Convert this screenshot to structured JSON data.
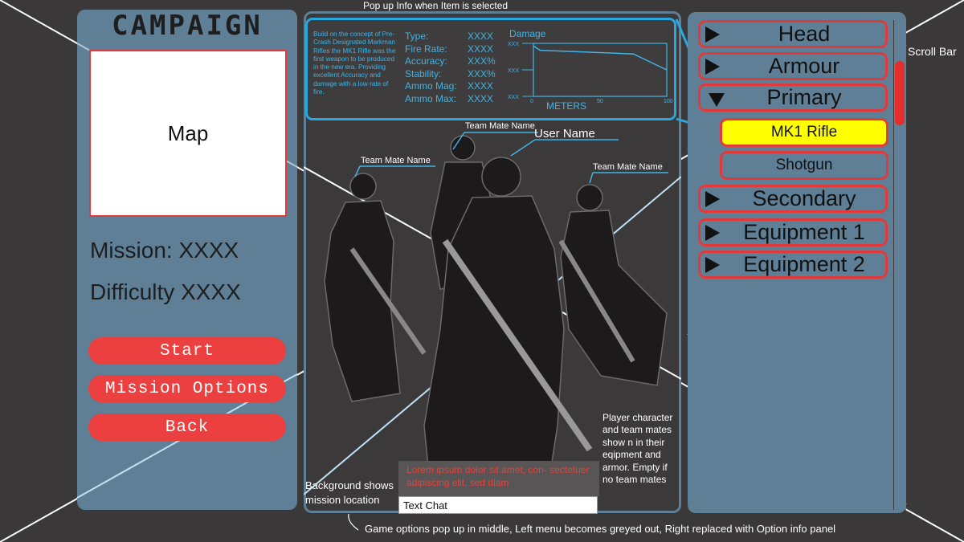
{
  "captions": {
    "popup": "Pop up Info when Item is selected",
    "bottom": "Game options pop up in middle,  Left menu becomes greyed out, Right replaced with Option info panel",
    "scroll_bar": "Scroll Bar",
    "background": "Background shows mission location",
    "player_note": "Player character and team mates show n in their eqipment and armor. Empty if no team mates"
  },
  "left": {
    "title": "CAMPAIGN",
    "map_label": "Map",
    "mission": "Mission: XXXX",
    "difficulty": "Difficulty XXXX",
    "buttons": {
      "start": "Start",
      "mission_options": "Mission Options",
      "back": "Back"
    }
  },
  "item_info": {
    "description": "Build on the concept of Pre-Crash Designated Markman Rifles the MK1 Rifle was the first weapon to be produced in the new era. Providing excellent Accuracy and damage with a low rate of fire.",
    "stats": [
      {
        "label": "Type:",
        "value": "XXXX"
      },
      {
        "label": "Fire Rate:",
        "value": "XXXX"
      },
      {
        "label": "Accuracy:",
        "value": "XXX%"
      },
      {
        "label": "Stability:",
        "value": "XXX%"
      },
      {
        "label": "Ammo Mag:",
        "value": "XXXX"
      },
      {
        "label": "Ammo Max:",
        "value": "XXXX"
      }
    ]
  },
  "chart_data": {
    "type": "line",
    "title": "Damage",
    "xlabel": "METERS",
    "ylabel": "",
    "x_ticks": [
      "0",
      "50",
      "100"
    ],
    "y_ticks": [
      "XXX",
      "XXX",
      "XXX"
    ],
    "xlim": [
      0,
      100
    ],
    "ylim": [
      0,
      1
    ],
    "x": [
      0,
      5,
      75,
      100
    ],
    "y": [
      0.95,
      0.87,
      0.8,
      0.5
    ]
  },
  "characters": {
    "user": "User Name",
    "teammate_left": "Team Mate Name",
    "teammate_back": "Team Mate Name",
    "teammate_right": "Team Mate Name"
  },
  "chat": {
    "messages": "Lorem ipsum dolor sit amet, con- sectetuer adipiscing elit, sed diam",
    "input_value": "Text Chat"
  },
  "loadout": {
    "categories": [
      {
        "label": "Head",
        "expanded": false
      },
      {
        "label": "Armour",
        "expanded": false
      },
      {
        "label": "Primary",
        "expanded": true
      },
      {
        "label": "Secondary",
        "expanded": false
      },
      {
        "label": "Equipment 1",
        "expanded": false
      },
      {
        "label": "Equipment 2",
        "expanded": false
      }
    ],
    "primary_items": [
      {
        "label": "MK1 Rifle",
        "selected": true
      },
      {
        "label": "Shotgun",
        "selected": false
      }
    ]
  },
  "colors": {
    "background": "#3a3838",
    "panel": "#5f7f96",
    "accent_red": "#ec3f3f",
    "selected_yellow": "#ffff00",
    "info_blue": "#29a8e0"
  },
  "icons": [
    "triangle-right-icon",
    "triangle-down-icon"
  ]
}
